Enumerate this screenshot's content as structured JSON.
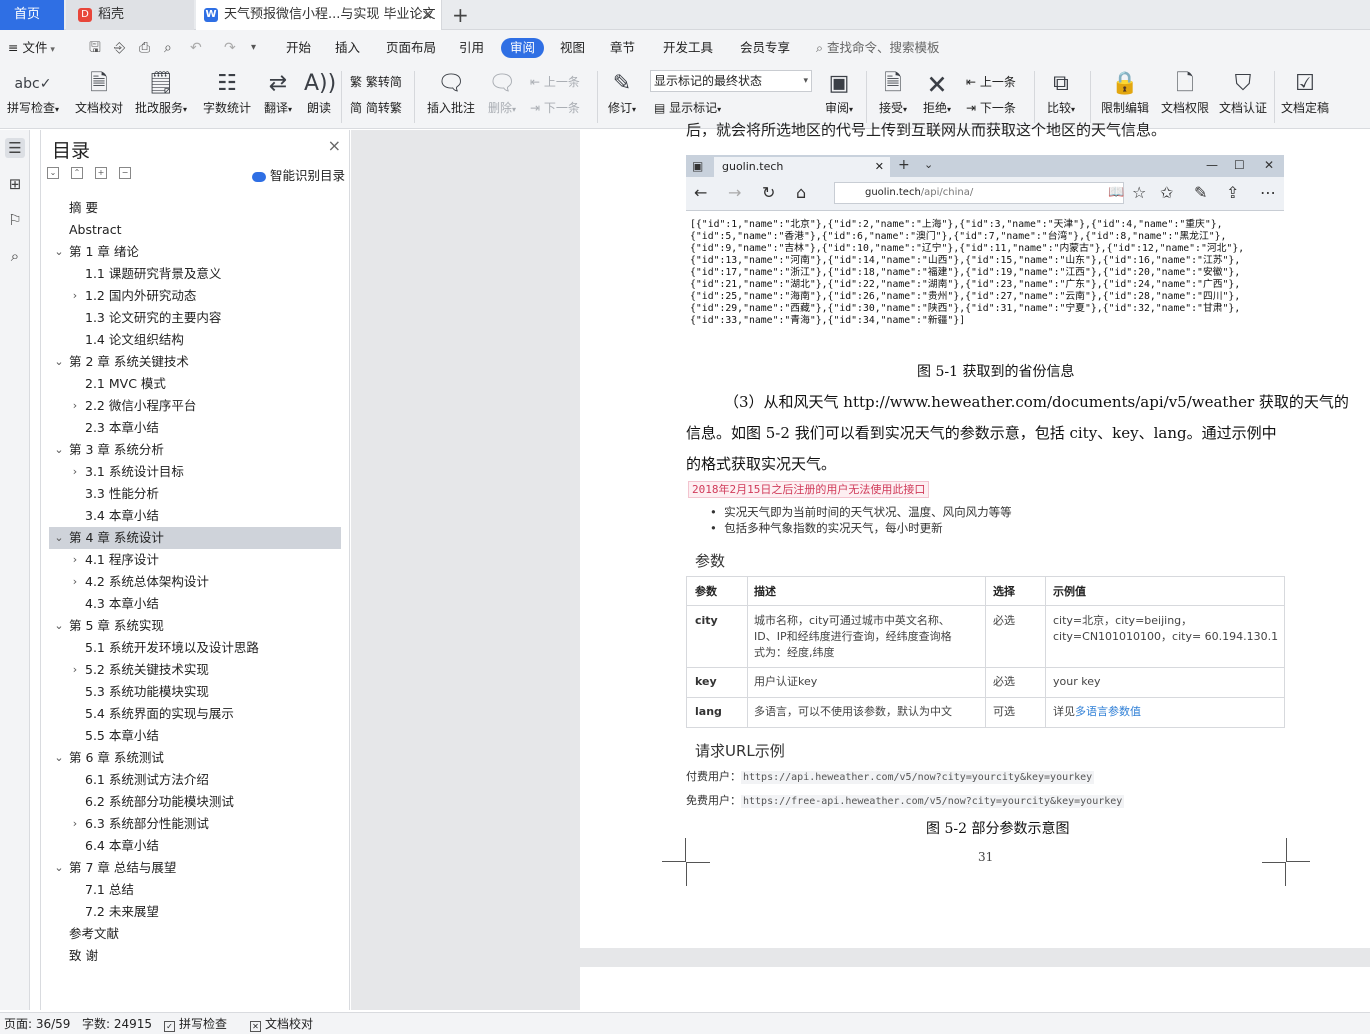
{
  "tabs": {
    "home": "首页",
    "daoke": "稻壳",
    "doc": "天气预报微信小程...与实现 毕业论文"
  },
  "menu": {
    "file": "文件",
    "items": [
      "开始",
      "插入",
      "页面布局",
      "引用",
      "审阅",
      "视图",
      "章节",
      "开发工具",
      "会员专享"
    ],
    "search": "查找命令、搜索模板"
  },
  "ribbon": {
    "spell_check": "拼写检查",
    "doc_proof": "文档校对",
    "batch_service": "批改服务",
    "word_count": "字数统计",
    "translate": "翻译",
    "read_aloud": "朗读",
    "to_traditional": "繁转简",
    "to_simplified": "简转繁",
    "insert_comment": "插入批注",
    "delete": "删除",
    "prev": "上一条",
    "next": "下一条",
    "revise": "修订",
    "track_state": "显示标记的最终状态",
    "show_marks": "显示标记",
    "review": "审阅",
    "accept": "接受",
    "reject": "拒绝",
    "prev2": "上一条",
    "next2": "下一条",
    "compare": "比较",
    "restrict_edit": "限制编辑",
    "doc_permission": "文档权限",
    "doc_certify": "文档认证",
    "doc_finalize": "文档定稿"
  },
  "nav": {
    "title": "目录",
    "smart_toc": "智能识别目录",
    "items": [
      {
        "text": "摘    要",
        "level": 1,
        "twisty": ""
      },
      {
        "text": "Abstract",
        "level": 1,
        "twisty": ""
      },
      {
        "text": "第 1 章  绪论",
        "level": 1,
        "twisty": "open"
      },
      {
        "text": "1.1 课题研究背景及意义",
        "level": 2,
        "twisty": ""
      },
      {
        "text": "1.2 国内外研究动态",
        "level": 2,
        "twisty": "closed"
      },
      {
        "text": "1.3 论文研究的主要内容",
        "level": 2,
        "twisty": ""
      },
      {
        "text": "1.4 论文组织结构",
        "level": 2,
        "twisty": ""
      },
      {
        "text": "第 2 章  系统关键技术",
        "level": 1,
        "twisty": "open"
      },
      {
        "text": "2.1 MVC 模式",
        "level": 2,
        "twisty": ""
      },
      {
        "text": "2.2  微信小程序平台",
        "level": 2,
        "twisty": "closed"
      },
      {
        "text": "2.3 本章小结",
        "level": 2,
        "twisty": ""
      },
      {
        "text": "第 3 章  系统分析",
        "level": 1,
        "twisty": "open"
      },
      {
        "text": "3.1 系统设计目标",
        "level": 2,
        "twisty": "closed"
      },
      {
        "text": "3.3 性能分析",
        "level": 2,
        "twisty": ""
      },
      {
        "text": "3.4 本章小结",
        "level": 2,
        "twisty": ""
      },
      {
        "text": "第 4 章  系统设计",
        "level": 1,
        "twisty": "open",
        "selected": true
      },
      {
        "text": "4.1 程序设计",
        "level": 2,
        "twisty": "closed"
      },
      {
        "text": "4.2 系统总体架构设计",
        "level": 2,
        "twisty": "closed"
      },
      {
        "text": "4.3 本章小结",
        "level": 2,
        "twisty": ""
      },
      {
        "text": "第 5 章  系统实现",
        "level": 1,
        "twisty": "open"
      },
      {
        "text": "5.1 系统开发环境以及设计思路",
        "level": 2,
        "twisty": ""
      },
      {
        "text": "5.2 系统关键技术实现",
        "level": 2,
        "twisty": "closed"
      },
      {
        "text": "5.3 系统功能模块实现",
        "level": 2,
        "twisty": ""
      },
      {
        "text": "5.4 系统界面的实现与展示",
        "level": 2,
        "twisty": ""
      },
      {
        "text": "5.5 本章小结",
        "level": 2,
        "twisty": ""
      },
      {
        "text": "第 6 章  系统测试",
        "level": 1,
        "twisty": "open"
      },
      {
        "text": "6.1 系统测试方法介绍",
        "level": 2,
        "twisty": ""
      },
      {
        "text": "6.2 系统部分功能模块测试",
        "level": 2,
        "twisty": ""
      },
      {
        "text": "6.3 系统部分性能测试",
        "level": 2,
        "twisty": "closed"
      },
      {
        "text": "6.4 本章小结",
        "level": 2,
        "twisty": ""
      },
      {
        "text": "第 7 章  总结与展望",
        "level": 1,
        "twisty": "open"
      },
      {
        "text": "7.1 总结",
        "level": 2,
        "twisty": ""
      },
      {
        "text": "7.2 未来展望",
        "level": 2,
        "twisty": ""
      },
      {
        "text": "参考文献",
        "level": 1,
        "twisty": ""
      },
      {
        "text": "致    谢",
        "level": 1,
        "twisty": ""
      }
    ]
  },
  "doc": {
    "clipped_line": "后，就会将所选地区的代号上传到互联网从而获取这个地区的天气信息。",
    "browser": {
      "tab_title": "guolin.tech",
      "url_host": "guolin.tech",
      "url_path": "/api/china/",
      "json": "[{\"id\":1,\"name\":\"北京\"},{\"id\":2,\"name\":\"上海\"},{\"id\":3,\"name\":\"天津\"},{\"id\":4,\"name\":\"重庆\"},\n{\"id\":5,\"name\":\"香港\"},{\"id\":6,\"name\":\"澳门\"},{\"id\":7,\"name\":\"台湾\"},{\"id\":8,\"name\":\"黑龙江\"},\n{\"id\":9,\"name\":\"吉林\"},{\"id\":10,\"name\":\"辽宁\"},{\"id\":11,\"name\":\"内蒙古\"},{\"id\":12,\"name\":\"河北\"},\n{\"id\":13,\"name\":\"河南\"},{\"id\":14,\"name\":\"山西\"},{\"id\":15,\"name\":\"山东\"},{\"id\":16,\"name\":\"江苏\"},\n{\"id\":17,\"name\":\"浙江\"},{\"id\":18,\"name\":\"福建\"},{\"id\":19,\"name\":\"江西\"},{\"id\":20,\"name\":\"安徽\"},\n{\"id\":21,\"name\":\"湖北\"},{\"id\":22,\"name\":\"湖南\"},{\"id\":23,\"name\":\"广东\"},{\"id\":24,\"name\":\"广西\"},\n{\"id\":25,\"name\":\"海南\"},{\"id\":26,\"name\":\"贵州\"},{\"id\":27,\"name\":\"云南\"},{\"id\":28,\"name\":\"四川\"},\n{\"id\":29,\"name\":\"西藏\"},{\"id\":30,\"name\":\"陕西\"},{\"id\":31,\"name\":\"宁夏\"},{\"id\":32,\"name\":\"甘肃\"},\n{\"id\":33,\"name\":\"青海\"},{\"id\":34,\"name\":\"新疆\"}]"
    },
    "caption1": "图 5-1    获取到的省份信息",
    "para_lines": [
      "（3）从和风天气 http://www.heweather.com/documents/api/v5/weather 获取的天气的",
      "信息。如图 5-2 我们可以看到实况天气的参数示意，包括 city、key、lang。通过示例中",
      "的格式获取实况天气。"
    ],
    "notice": "2018年2月15日之后注册的用户无法使用此接口",
    "bullets": [
      "实况天气即为当前时间的天气状况、温度、风向风力等等",
      "包括多种气象指数的实况天气，每小时更新"
    ],
    "params_heading": "参数",
    "table": {
      "headers": [
        "参数",
        "描述",
        "选择",
        "示例值"
      ],
      "rows": [
        {
          "param": "city",
          "desc": [
            "城市名称，city可通过城市中英文名称、",
            "ID、IP和经纬度进行查询，经纬度查询格",
            "式为：经度,纬度"
          ],
          "choice": "必选",
          "example": [
            "city=北京，city=beijing，",
            "city=CN101010100，city= 60.194.130.1"
          ]
        },
        {
          "param": "key",
          "desc": [
            "用户认证key"
          ],
          "choice": "必选",
          "example": [
            "your key"
          ]
        },
        {
          "param": "lang",
          "desc": [
            "多语言，可以不使用该参数，默认为中文"
          ],
          "choice": "可选",
          "example_prefix": "详见",
          "example_link": "多语言参数值"
        }
      ]
    },
    "url_heading": "请求URL示例",
    "paid_label": "付费用户：",
    "paid_url": "https://api.heweather.com/v5/now?city=yourcity&key=yourkey",
    "free_label": "免费用户：",
    "free_url": "https://free-api.heweather.com/v5/now?city=yourcity&key=yourkey",
    "caption2": "图 5-2    部分参数示意图",
    "page_number": "31"
  },
  "status": {
    "page": "页面: 36/59",
    "words": "字数: 24915",
    "spell": "拼写检查",
    "proof": "文档校对"
  },
  "colors": {
    "accent": "#2f6fe4",
    "selected_toc": "#cfd3da",
    "notice": "#d03b5a",
    "link": "#2f7fd6"
  }
}
